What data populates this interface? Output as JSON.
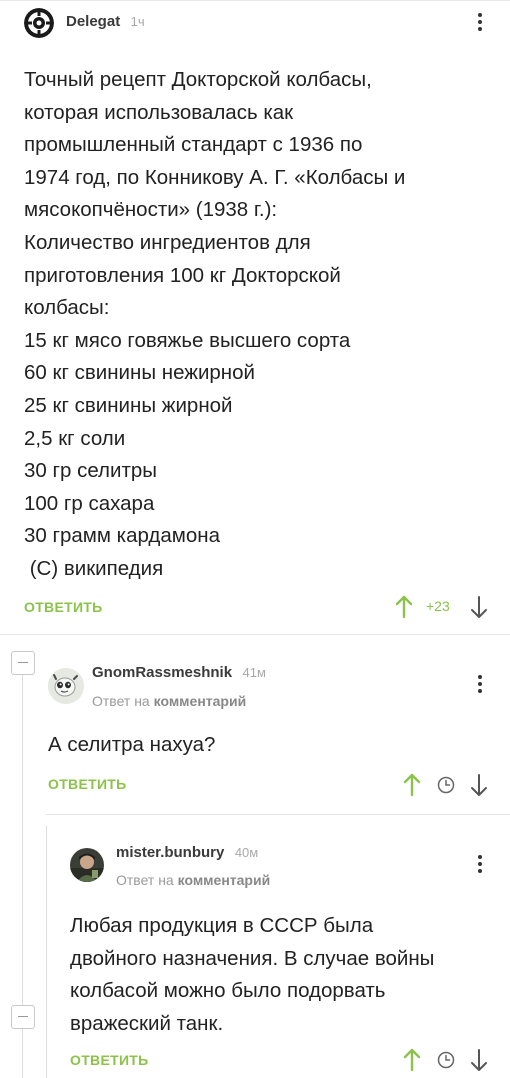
{
  "comment1": {
    "author": "Delegat",
    "time": "1ч",
    "lines": [
      "Точный рецепт Докторской колбасы,",
      "которая использовалась как",
      "промышленный стандарт с 1936 по",
      "1974 год, по Конникову А. Г. «Колбасы и",
      "мясокопчёности» (1938 г.):",
      "Количество ингредиентов для",
      "приготовления 100 кг Докторской",
      "колбасы:",
      "15 кг мясо говяжье высшего сорта",
      "60 кг свинины нежирной",
      "25 кг свинины жирной",
      "2,5 кг соли",
      "30 гр селитры",
      "100 гр сахара",
      "30 грамм кардамона",
      " (С) википедия"
    ],
    "reply_label": "ОТВЕТИТЬ",
    "rating": "+23",
    "upvote_icon": "arrow-up-icon",
    "downvote_icon": "arrow-down-icon"
  },
  "comment2": {
    "author": "GnomRassmeshnik",
    "time": "41м",
    "reply_to_prefix": "Ответ на",
    "reply_to_target": "комментарий",
    "text": "А селитра нахуа?",
    "reply_label": "ОТВЕТИТЬ",
    "rating_icon": "clock-icon"
  },
  "comment3": {
    "author": "mister.bunbury",
    "time": "40м",
    "reply_to_prefix": "Ответ на",
    "reply_to_target": "комментарий",
    "lines": [
      "Любая продукция в СССР была",
      "двойного назначения. В случае войны",
      "колбасой можно было подорвать",
      "вражеский танк."
    ],
    "reply_label": "ОТВЕТИТЬ",
    "rating_icon": "clock-icon"
  },
  "colors": {
    "accent_green": "#8bc34a",
    "text": "#222222",
    "muted": "#a8a8a8"
  }
}
